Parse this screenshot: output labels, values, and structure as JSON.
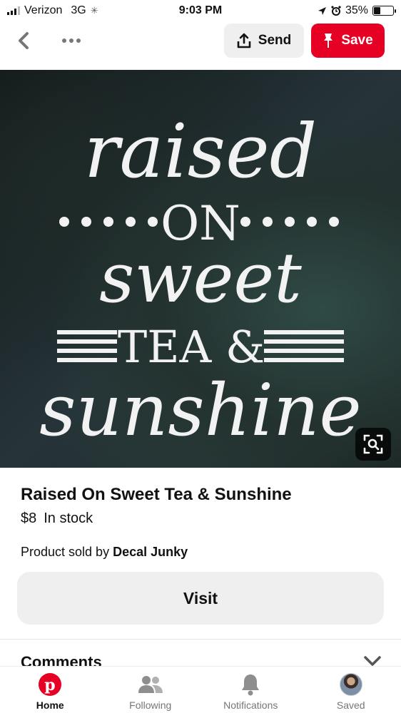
{
  "status_bar": {
    "carrier": "Verizon",
    "network": "3G",
    "time": "9:03 PM",
    "battery": "35%",
    "battery_level": 0.35
  },
  "nav": {
    "send_label": "Send",
    "save_label": "Save",
    "accent_color": "#e60023"
  },
  "pin": {
    "image_text": [
      "raised",
      "ON",
      "sweet",
      "TEA &",
      "sunshine"
    ],
    "title": "Raised On Sweet Tea & Sunshine",
    "price": "$8",
    "stock": "In stock",
    "seller_prefix": "Product sold by",
    "seller_name": "Decal Junky",
    "visit_label": "Visit",
    "comments_label": "Comments"
  },
  "tabs": [
    {
      "label": "Home",
      "icon": "pinterest-logo-icon",
      "active": true
    },
    {
      "label": "Following",
      "icon": "people-icon",
      "active": false
    },
    {
      "label": "Notifications",
      "icon": "bell-icon",
      "active": false
    },
    {
      "label": "Saved",
      "icon": "avatar",
      "active": false
    }
  ]
}
